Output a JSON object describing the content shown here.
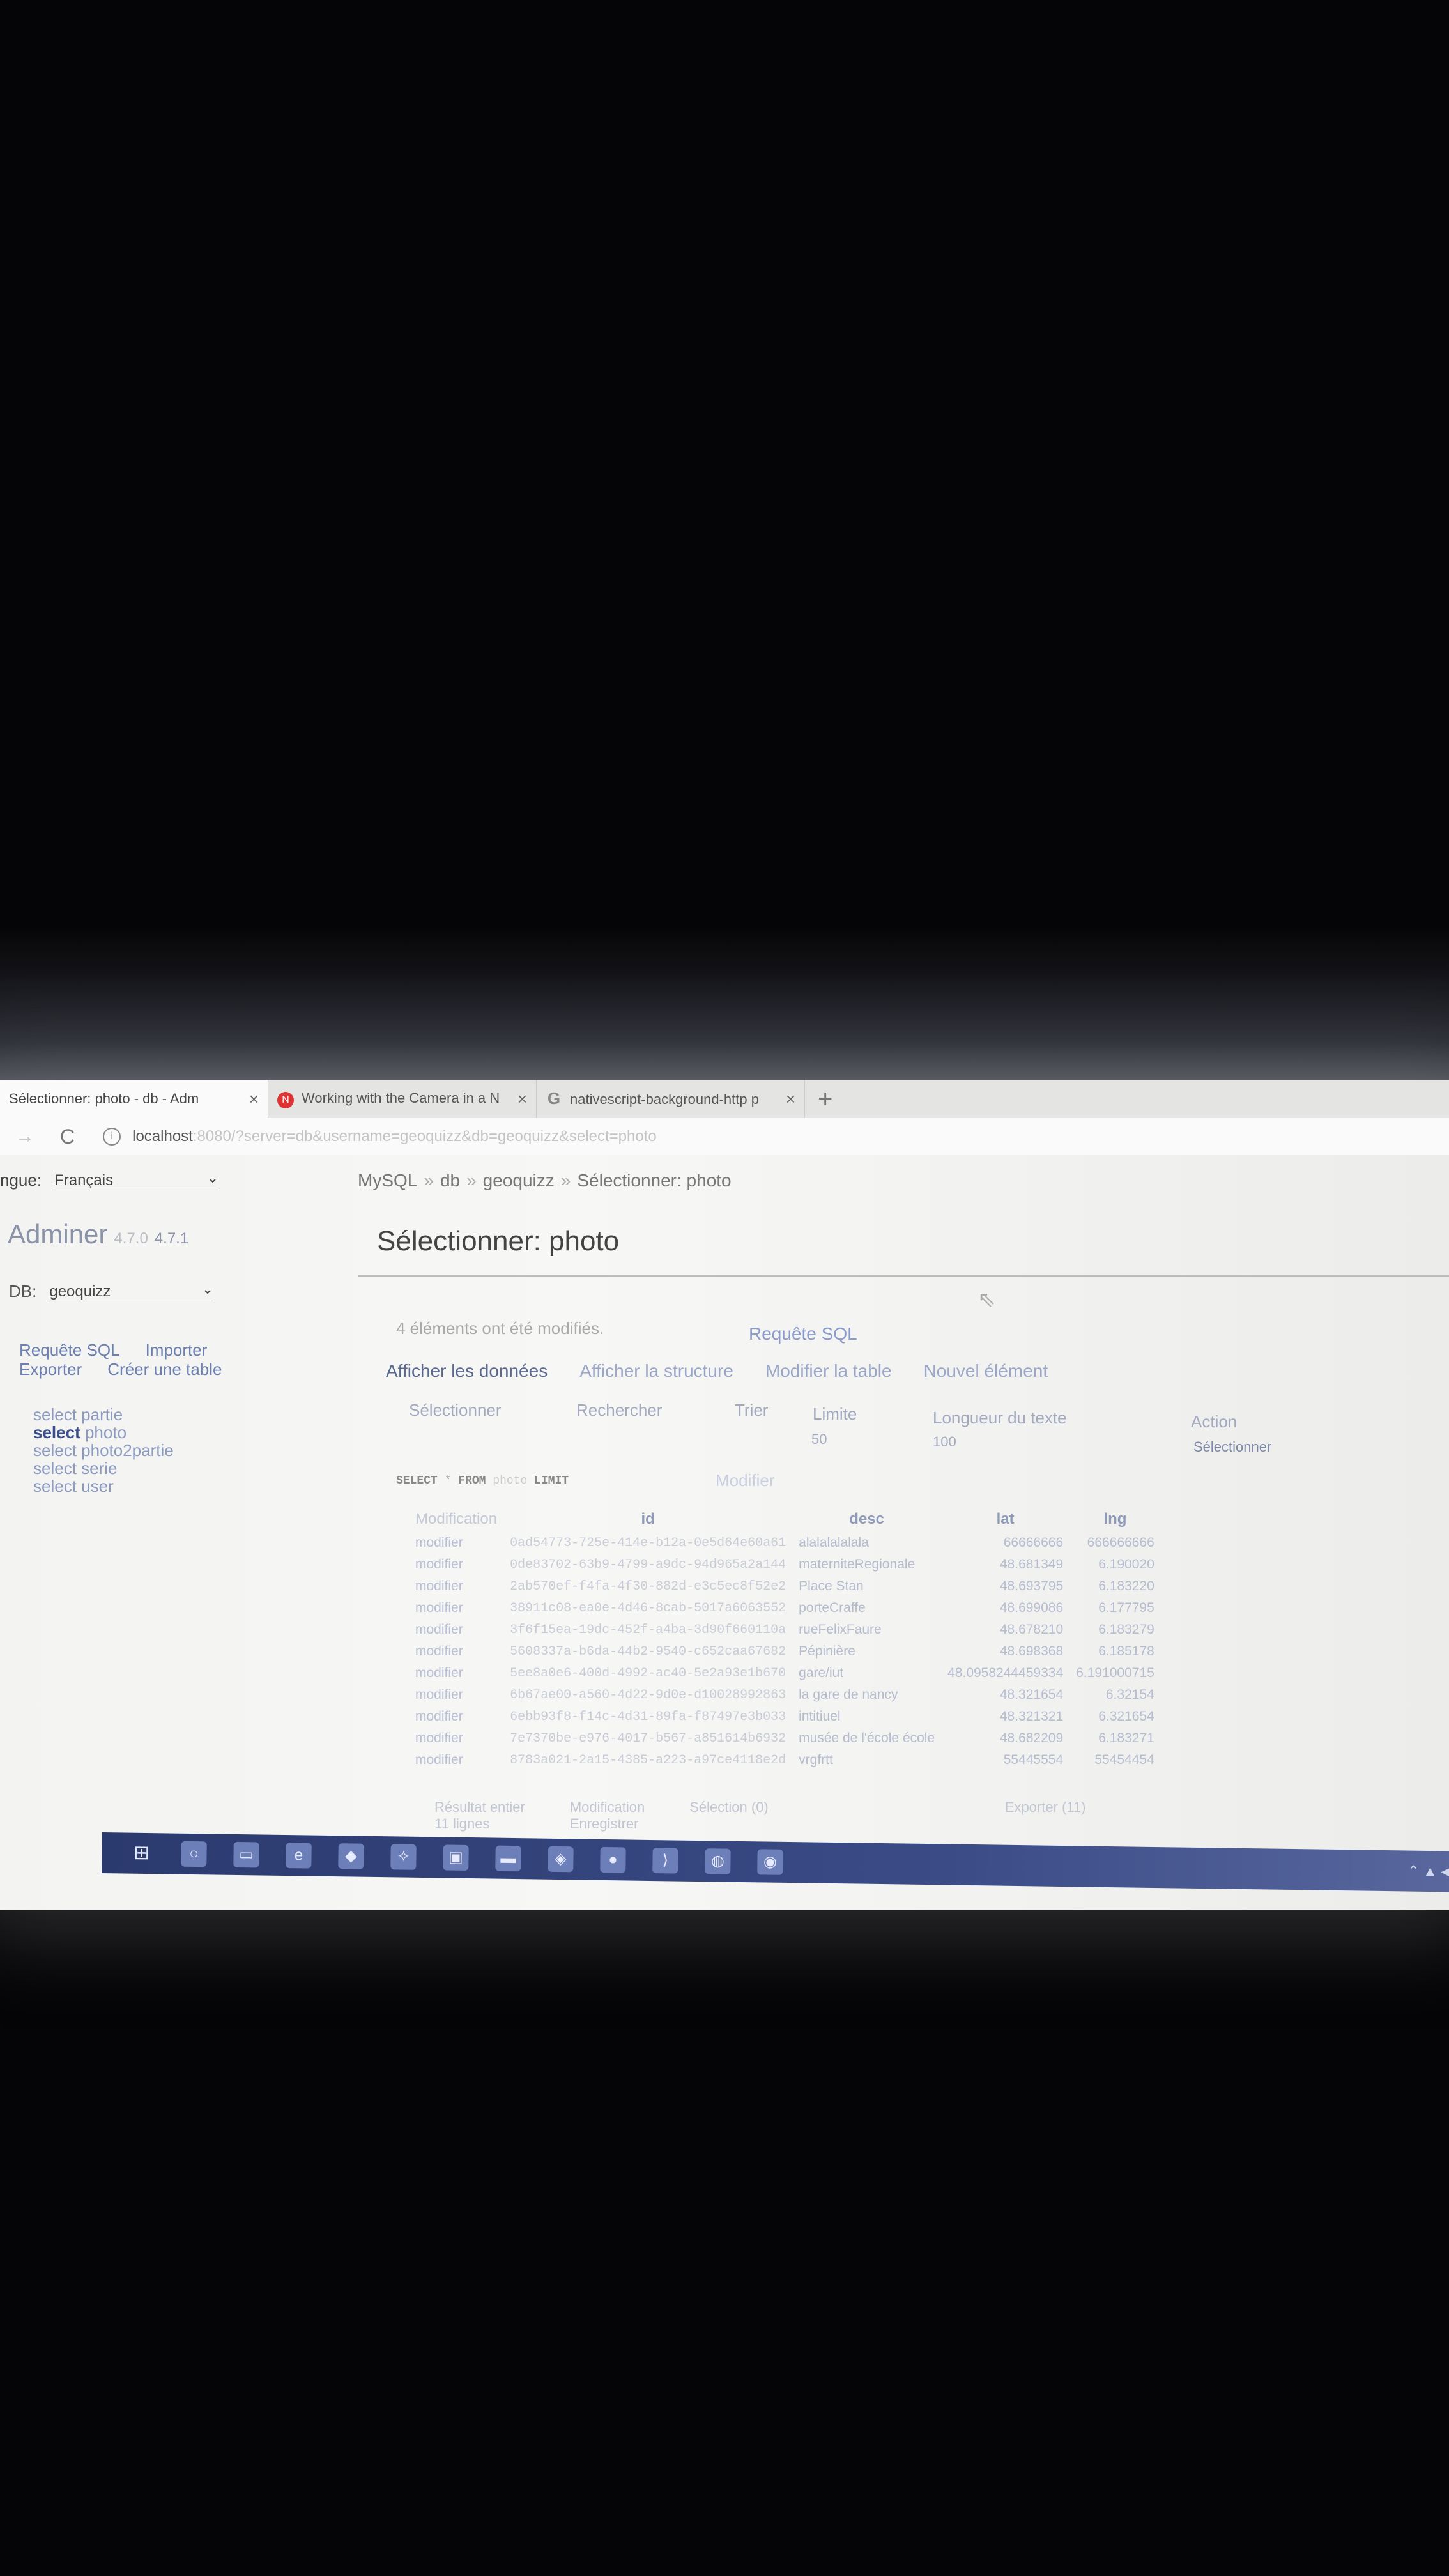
{
  "browser": {
    "tabs": [
      {
        "title": "Sélectionner: photo - db - Adm",
        "icon": "adminer-page-icon",
        "active": true
      },
      {
        "title": "Working with the Camera in a N",
        "icon": "nativescript-icon",
        "active": false
      },
      {
        "title": "nativescript-background-http p",
        "icon": "google-icon",
        "active": false
      }
    ],
    "new_tab": "+",
    "close": "×",
    "url_host": "localhost",
    "url_rest": ":8080/?server=db&username=geoquizz&db=geoquizz&select=photo"
  },
  "sidebar": {
    "lang_label": "ngue:",
    "lang_value": "Français",
    "logo": "Adminer",
    "version_old": "4.7.0",
    "version_new": "4.7.1",
    "db_label": "DB:",
    "db_value": "geoquizz",
    "links": [
      "Requête SQL",
      "Importer",
      "Exporter",
      "Créer une table"
    ],
    "tables": [
      {
        "prefix": "select",
        "name": "partie",
        "current": false
      },
      {
        "prefix": "select",
        "name": "photo",
        "current": true
      },
      {
        "prefix": "select",
        "name": "photo2partie",
        "current": false
      },
      {
        "prefix": "select",
        "name": "serie",
        "current": false
      },
      {
        "prefix": "select",
        "name": "user",
        "current": false
      }
    ]
  },
  "main": {
    "breadcrumb": [
      "MySQL",
      "db",
      "geoquizz",
      "Sélectionner: photo"
    ],
    "breadcrumb_sep": "»",
    "title": "Sélectionner: photo",
    "message": "4 éléments ont été modifiés.",
    "sql_link": "Requête SQL",
    "menu": [
      "Afficher les données",
      "Afficher la structure",
      "Modifier la table",
      "Nouvel élément"
    ],
    "options": {
      "select": "Sélectionner",
      "search": "Rechercher",
      "sort": "Trier",
      "limit_label": "Limite",
      "limit_value": "50",
      "text_length_label": "Longueur du texte",
      "text_length_value": "100",
      "action_label": "Action",
      "action_button": "Sélectionner"
    },
    "query": {
      "kw1": "SELECT",
      "star": "*",
      "kw2": "FROM",
      "table": "photo",
      "kw3": "LIMIT"
    },
    "query_edit": "Modifier",
    "columns": [
      "Modification",
      "id",
      "desc",
      "lat",
      "lng"
    ],
    "rows": [
      {
        "mod": "modifier",
        "id": "0ad54773-725e-414e-b12a-0e5d64e60a61",
        "desc": "alalalalalala",
        "lat": "66666666",
        "lng": "666666666"
      },
      {
        "mod": "modifier",
        "id": "0de83702-63b9-4799-a9dc-94d965a2a144",
        "desc": "materniteRegionale",
        "lat": "48.681349",
        "lng": "6.190020"
      },
      {
        "mod": "modifier",
        "id": "2ab570ef-f4fa-4f30-882d-e3c5ec8f52e2",
        "desc": "Place Stan",
        "lat": "48.693795",
        "lng": "6.183220"
      },
      {
        "mod": "modifier",
        "id": "38911c08-ea0e-4d46-8cab-5017a6063552",
        "desc": "porteCraffe",
        "lat": "48.699086",
        "lng": "6.177795"
      },
      {
        "mod": "modifier",
        "id": "3f6f15ea-19dc-452f-a4ba-3d90f660110a",
        "desc": "rueFelixFaure",
        "lat": "48.678210",
        "lng": "6.183279"
      },
      {
        "mod": "modifier",
        "id": "5608337a-b6da-44b2-9540-c652caa67682",
        "desc": "Pépinière",
        "lat": "48.698368",
        "lng": "6.185178"
      },
      {
        "mod": "modifier",
        "id": "5ee8a0e6-400d-4992-ac40-5e2a93e1b670",
        "desc": "gare/iut",
        "lat": "48.0958244459334",
        "lng": "6.191000715"
      },
      {
        "mod": "modifier",
        "id": "6b67ae00-a560-4d22-9d0e-d10028992863",
        "desc": "la gare de nancy",
        "lat": "48.321654",
        "lng": "6.32154"
      },
      {
        "mod": "modifier",
        "id": "6ebb93f8-f14c-4d31-89fa-f87497e3b033",
        "desc": "intitiuel",
        "lat": "48.321321",
        "lng": "6.321654"
      },
      {
        "mod": "modifier",
        "id": "7e7370be-e976-4017-b567-a851614b6932",
        "desc": "musée de l'école école",
        "lat": "48.682209",
        "lng": "6.183271"
      },
      {
        "mod": "modifier",
        "id": "8783a021-2a15-4385-a223-a97ce4118e2d",
        "desc": "vrgfrtt",
        "lat": "55445554",
        "lng": "55454454"
      }
    ],
    "footer": [
      "Résultat entier",
      "Modification",
      "Sélection (0)",
      "Exporter (11)"
    ],
    "footer_sub": [
      "11 lignes",
      "Enregistrer"
    ]
  },
  "taskbar": {
    "icons": [
      "windows-icon",
      "cortana-icon",
      "taskview-icon",
      "edge-icon",
      "visual-studio-icon",
      "network-icon",
      "app-icon",
      "folder-icon",
      "git-icon",
      "chrome-icon",
      "vscode-icon",
      "app2-icon",
      "app3-icon"
    ],
    "tray": "⌃ ▲ ◀ ▦"
  }
}
